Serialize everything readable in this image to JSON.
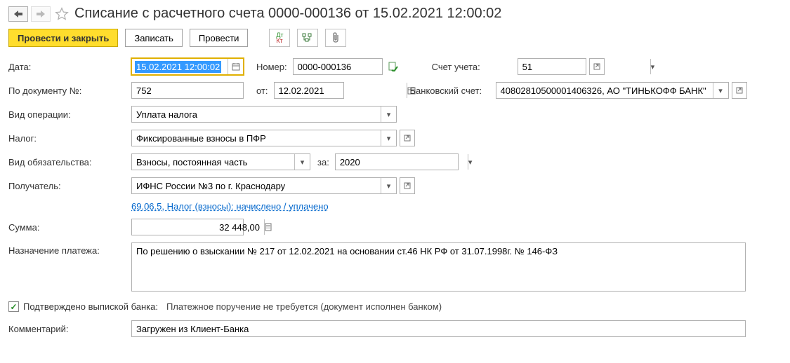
{
  "header": {
    "title": "Списание с расчетного счета 0000-000136 от 15.02.2021 12:00:02"
  },
  "toolbar": {
    "post_close": "Провести и закрыть",
    "write": "Записать",
    "post": "Провести"
  },
  "labels": {
    "date": "Дата:",
    "number": "Номер:",
    "account": "Счет учета:",
    "doc_no": "По документу №:",
    "from": "от:",
    "bank_account": "Банковский счет:",
    "op_type": "Вид операции:",
    "tax": "Налог:",
    "obligation": "Вид обязательства:",
    "for": "за:",
    "recipient": "Получатель:",
    "sum": "Сумма:",
    "purpose": "Назначение платежа:",
    "confirmed": "Подтверждено выпиской банка:",
    "no_payment_order": "Платежное поручение не требуется (документ исполнен банком)",
    "comment": "Комментарий:"
  },
  "values": {
    "date": "15.02.2021 12:00:02",
    "number": "0000-000136",
    "account": "51",
    "doc_no": "752",
    "doc_date": "12.02.2021",
    "bank_account": "40802810500001406326, АО \"ТИНЬКОФФ БАНК\"",
    "op_type": "Уплата налога",
    "tax": "Фиксированные взносы в ПФР",
    "obligation": "Взносы, постоянная часть",
    "year": "2020",
    "recipient": "ИФНС России №3 по г. Краснодару",
    "link": "69.06.5, Налог (взносы): начислено / уплачено",
    "sum": "32 448,00",
    "purpose": "По решению о взыскании № 217 от 12.02.2021 на основании ст.46 НК РФ от 31.07.1998г. № 146-ФЗ",
    "comment": "Загружен из Клиент-Банка"
  }
}
